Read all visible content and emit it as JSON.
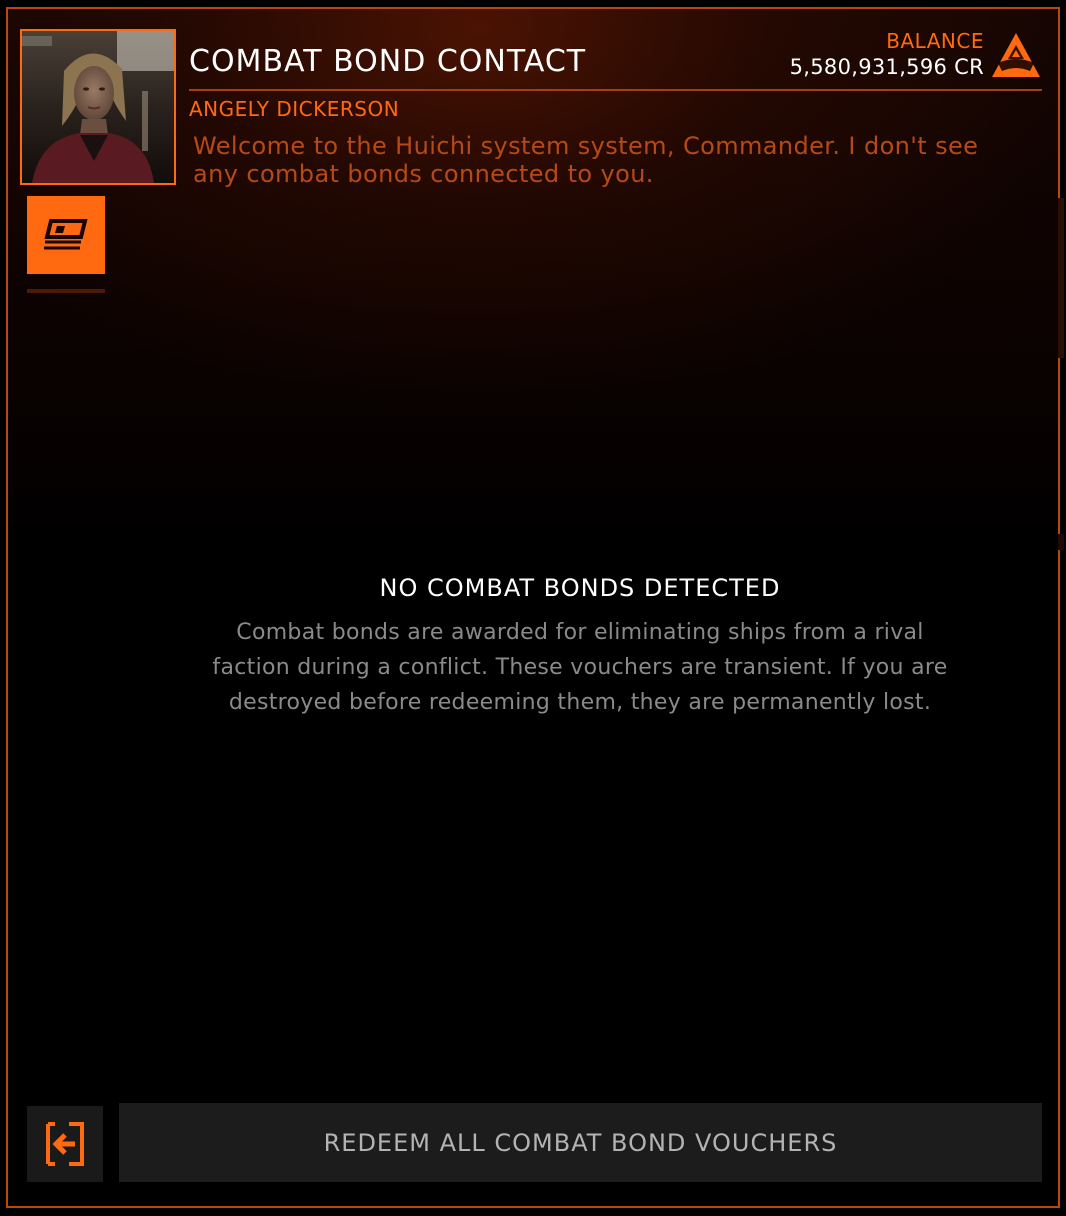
{
  "header": {
    "title": "COMBAT BOND CONTACT",
    "contact_name": "ANGELY DICKERSON",
    "greeting": "Welcome to the Huichi system system, Commander. I don't see any combat bonds connected to you."
  },
  "balance": {
    "label": "BALANCE",
    "value": "5,580,931,596 CR",
    "faction_icon": "faction-triangle-icon"
  },
  "sidebar": {
    "tabs": [
      {
        "icon": "combat-bond-icon",
        "active": true
      }
    ]
  },
  "main": {
    "empty_title": "NO COMBAT BONDS DETECTED",
    "empty_body": "Combat bonds are awarded for eliminating ships from a rival faction during a conflict. These vouchers are transient. If you are destroyed before redeeming them, they are permanently lost."
  },
  "footer": {
    "exit_icon": "exit-icon",
    "redeem_label": "REDEEM ALL COMBAT BOND VOUCHERS"
  },
  "colors": {
    "accent": "#ff6a10",
    "frame": "#b8480e",
    "greeting_text": "#b54a16",
    "muted_text": "#8a8a8a",
    "button_bg": "#1c1c1c"
  }
}
